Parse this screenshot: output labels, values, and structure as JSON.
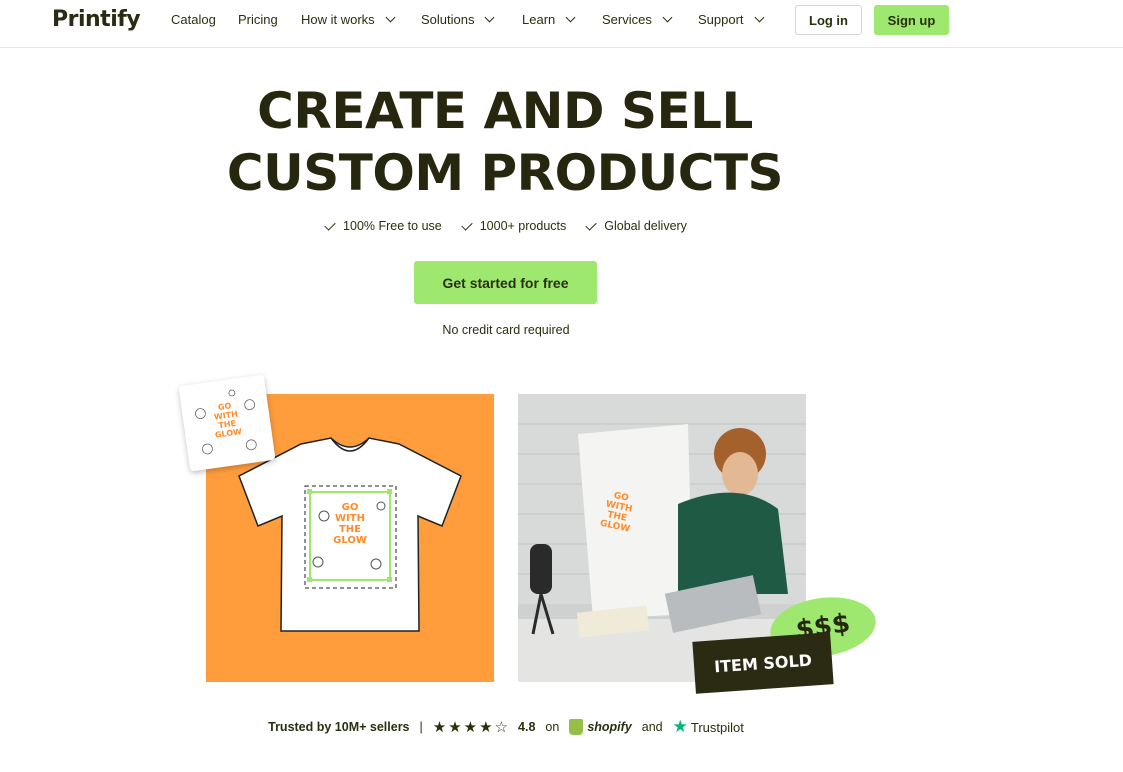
{
  "nav": {
    "logo": "Printify",
    "items": [
      {
        "label": "Catalog",
        "dropdown": false
      },
      {
        "label": "Pricing",
        "dropdown": false
      },
      {
        "label": "How it works",
        "dropdown": true
      },
      {
        "label": "Solutions",
        "dropdown": true
      },
      {
        "label": "Learn",
        "dropdown": true
      },
      {
        "label": "Services",
        "dropdown": true
      },
      {
        "label": "Support",
        "dropdown": true
      }
    ],
    "login": "Log in",
    "signup": "Sign up"
  },
  "hero": {
    "line1": "CREATE AND SELL",
    "line2": "CUSTOM PRODUCTS",
    "features": [
      "100% Free to use",
      "1000+ products",
      "Global delivery"
    ],
    "cta": "Get started for free",
    "note": "No credit card required"
  },
  "visuals": {
    "design_text": "GO WITH THE GLOW",
    "money_badge": "$$$",
    "sold_badge": "ITEM SOLD"
  },
  "trust": {
    "sellers": "Trusted by 10M+ sellers",
    "separator": "|",
    "rating": "4.8",
    "on": "on",
    "shopify": "shopify",
    "and": "and",
    "trustpilot": "Trustpilot"
  },
  "colors": {
    "accent": "#9fe870",
    "orange": "#ff9d3d",
    "dark": "#27270f"
  }
}
